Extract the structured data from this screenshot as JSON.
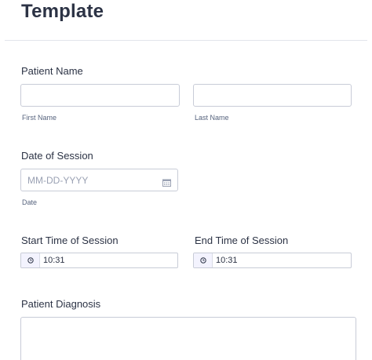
{
  "form": {
    "title": "Template",
    "patient_name": {
      "label": "Patient Name",
      "first_name_sublabel": "First Name",
      "last_name_sublabel": "Last Name",
      "first_name_value": "",
      "last_name_value": ""
    },
    "date_of_session": {
      "label": "Date of Session",
      "placeholder": "MM-DD-YYYY",
      "sublabel": "Date",
      "icon": "calendar-icon"
    },
    "start_time": {
      "label": "Start Time of Session",
      "value": "10:31",
      "icon": "clock-icon"
    },
    "end_time": {
      "label": "End Time of Session",
      "value": "10:31",
      "icon": "clock-icon"
    },
    "patient_diagnosis": {
      "label": "Patient Diagnosis",
      "value": ""
    }
  }
}
